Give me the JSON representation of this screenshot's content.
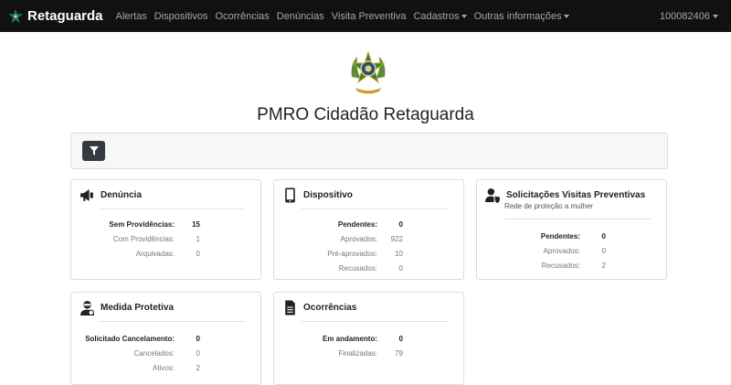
{
  "navbar": {
    "brand": "Retaguarda",
    "items": [
      {
        "label": "Alertas",
        "dropdown": false
      },
      {
        "label": "Dispositivos",
        "dropdown": false
      },
      {
        "label": "Ocorrências",
        "dropdown": false
      },
      {
        "label": "Denúncias",
        "dropdown": false
      },
      {
        "label": "Visita Preventiva",
        "dropdown": false
      },
      {
        "label": "Cadastros",
        "dropdown": true
      },
      {
        "label": "Outras informações",
        "dropdown": true
      }
    ],
    "user": "100082406"
  },
  "page": {
    "title": "PMRO Cidadão Retaguarda"
  },
  "filter": {
    "icon": "filter-icon"
  },
  "cards": {
    "denuncia": {
      "title": "Denúncia",
      "icon": "megaphone-icon",
      "rows": [
        {
          "label": "Sem Providências:",
          "value": "15"
        },
        {
          "label": "Com Providências:",
          "value": "1"
        },
        {
          "label": "Arquivadas:",
          "value": "0"
        }
      ]
    },
    "dispositivo": {
      "title": "Dispositivo",
      "icon": "mobile-icon",
      "rows": [
        {
          "label": "Pendentes:",
          "value": "0"
        },
        {
          "label": "Aprovados:",
          "value": "922"
        },
        {
          "label": "Pré-aprovados:",
          "value": "10"
        },
        {
          "label": "Recusados:",
          "value": "0"
        }
      ]
    },
    "visitas": {
      "title": "Solicitações Visitas Preventivas",
      "icon": "user-shield-icon",
      "subtitle": "Rede de proteção a mulher",
      "rows": [
        {
          "label": "Pendentes:",
          "value": "0"
        },
        {
          "label": "Aprovados:",
          "value": "0"
        },
        {
          "label": "Recusados:",
          "value": "2"
        }
      ]
    },
    "medida": {
      "title": "Medida Protetiva",
      "icon": "user-mask-icon",
      "rows": [
        {
          "label": "Solicitado Cancelamento:",
          "value": "0"
        },
        {
          "label": "Cancelados:",
          "value": "0"
        },
        {
          "label": "Ativos:",
          "value": "2"
        }
      ]
    },
    "ocorrencias": {
      "title": "Ocorrências",
      "icon": "document-icon",
      "rows": [
        {
          "label": "Em andamento:",
          "value": "0"
        },
        {
          "label": "Finalizadas:",
          "value": "79"
        }
      ]
    }
  }
}
